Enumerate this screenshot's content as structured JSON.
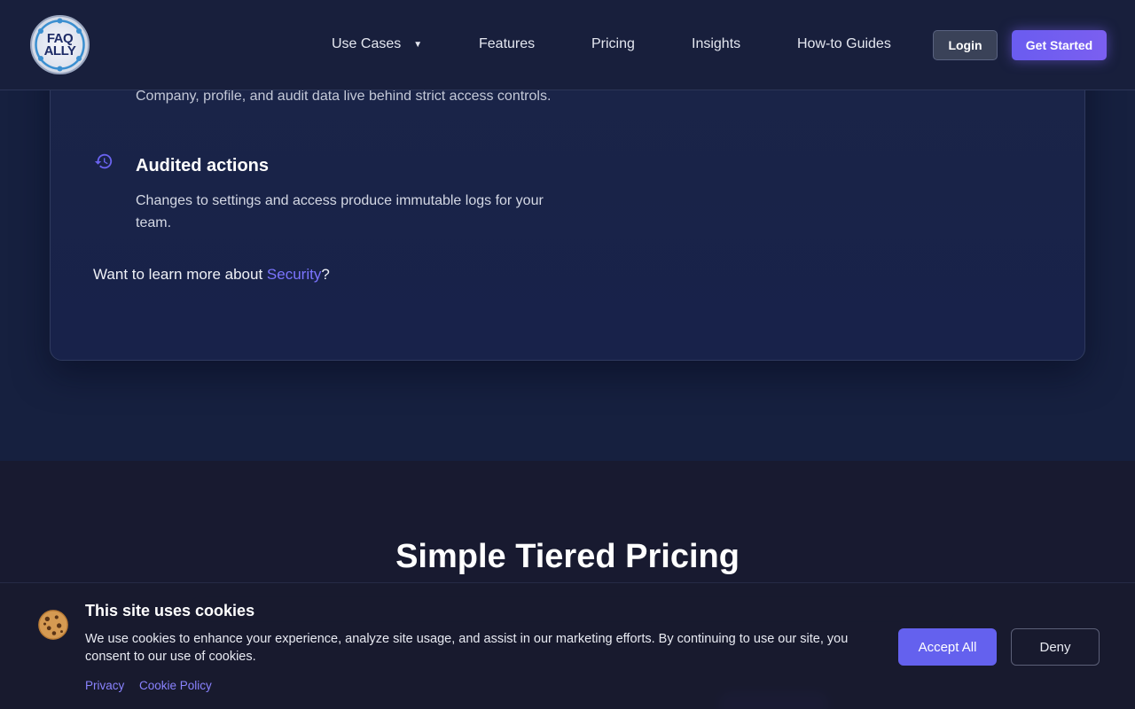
{
  "nav": {
    "logo_line1": "FAQ",
    "logo_line2": "ALLY",
    "items": [
      {
        "label": "Use Cases",
        "caret": "▼"
      },
      {
        "label": "Features"
      },
      {
        "label": "Pricing"
      },
      {
        "label": "Insights"
      },
      {
        "label": "How-to Guides"
      }
    ],
    "login_label": "Login",
    "get_started_label": "Get Started"
  },
  "security": {
    "access_text": "Company, profile, and audit data live behind strict access controls.",
    "audited_title": "Audited actions",
    "audited_icon": "history-icon",
    "audited_desc": "Changes to settings and access produce immutable logs for your team.",
    "learn_prefix": "Want to learn more about ",
    "learn_link": "Security",
    "learn_suffix": "?"
  },
  "pricing": {
    "title": "Simple Tiered Pricing"
  },
  "cookie_banner": {
    "icon": "cookie-icon",
    "title": "This site uses cookies",
    "text": "We use cookies to enhance your experience, analyze site usage, and assist in our marketing efforts. By continuing to use our site, you consent to our use of cookies.",
    "privacy_link": "Privacy",
    "cookie_policy_link": "Cookie Policy",
    "accept_label": "Accept All",
    "deny_label": "Deny"
  },
  "colors": {
    "accent": "#6461ee",
    "link": "#7b74ff",
    "background": "#16203f"
  }
}
